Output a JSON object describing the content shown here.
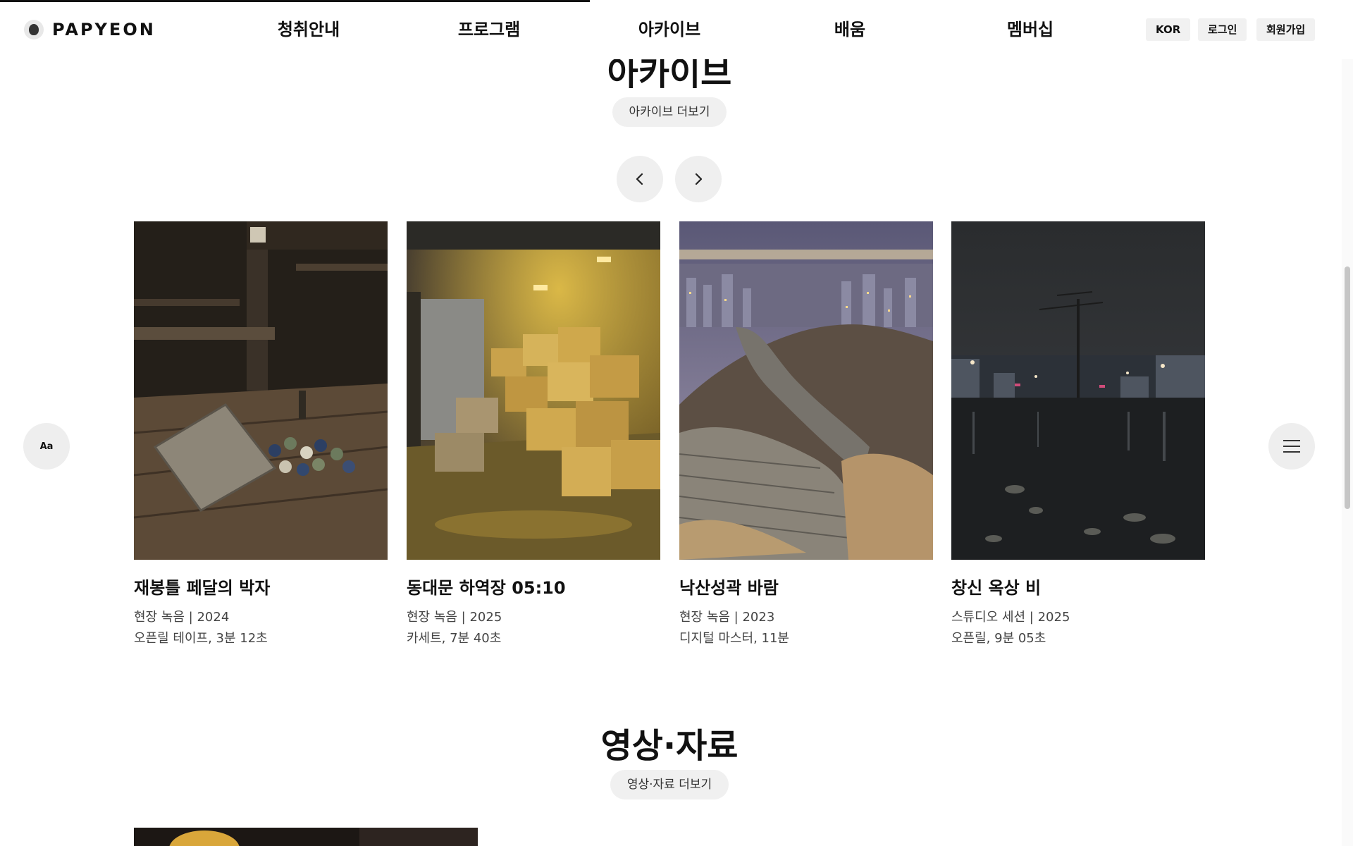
{
  "page": {
    "scroll_progress": 0.436
  },
  "header": {
    "logo_text": "PAPYEON",
    "nav": [
      {
        "label": "청취안내"
      },
      {
        "label": "프로그램"
      },
      {
        "label": "아카이브"
      },
      {
        "label": "배움"
      },
      {
        "label": "멤버십"
      }
    ],
    "lang_label": "KOR",
    "login_label": "로그인",
    "signup_label": "회원가입"
  },
  "archive": {
    "title": "아카이브",
    "more_label": "아카이브 더보기",
    "prev_icon": "chevron-left-icon",
    "next_icon": "chevron-right-icon",
    "cards": [
      {
        "title": "재봉틀 페달의 박자",
        "meta1": "현장 녹음 | 2024",
        "meta2": "오픈릴 테이프, 3분 12초"
      },
      {
        "title": "동대문 하역장 05:10",
        "meta1": "현장 녹음 | 2025",
        "meta2": "카세트, 7분 40초"
      },
      {
        "title": "낙산성곽 바람",
        "meta1": "현장 녹음 | 2023",
        "meta2": "디지털 마스터, 11분"
      },
      {
        "title": "창신 옥상 비",
        "meta1": "스튜디오 세션 | 2025",
        "meta2": "오픈릴, 9분 05초"
      }
    ]
  },
  "video": {
    "title": "영상·자료",
    "more_label": "영상·자료 더보기"
  },
  "floating": {
    "font_label": "Aa",
    "menu_icon": "hamburger-menu-icon"
  }
}
